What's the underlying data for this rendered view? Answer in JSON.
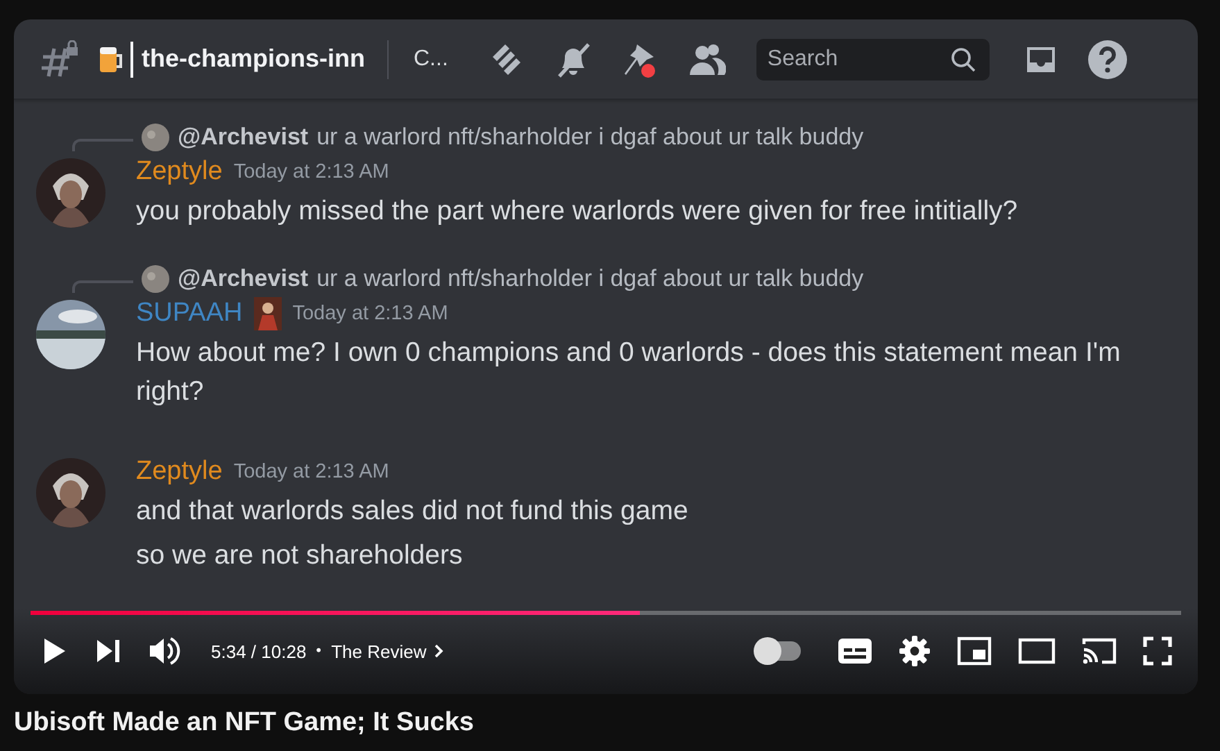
{
  "header": {
    "channel": "the-champions-inn",
    "topic": "C...",
    "search_placeholder": "Search"
  },
  "messages": [
    {
      "reply": {
        "author": "@Archevist",
        "text": "ur a warlord nft/sharholder i dgaf about ur talk buddy"
      },
      "author": "Zeptyle",
      "color": "#e08a1e",
      "role_icon": false,
      "time": "Today at 2:13 AM",
      "lines": [
        "you probably missed the part where warlords were given for free intitially?"
      ]
    },
    {
      "reply": {
        "author": "@Archevist",
        "text": "ur a warlord nft/sharholder i dgaf about ur talk buddy"
      },
      "author": "SUPAAH",
      "color": "#3f86c4",
      "role_icon": true,
      "time": "Today at 2:13 AM",
      "lines": [
        "How about me? I own 0 champions and 0 warlords - does this statement mean I'm right?"
      ]
    },
    {
      "author": "Zeptyle",
      "color": "#e08a1e",
      "role_icon": false,
      "time": "Today at 2:13 AM",
      "lines": [
        "and that warlords sales did not fund this game",
        "so we are not shareholders"
      ]
    }
  ],
  "player": {
    "level": 0.53,
    "playing": false,
    "time": "5:34 / 10:28",
    "separator": "•",
    "chapter": "The Review",
    "autoplay_on": false
  },
  "title": "Ubisoft Made an NFT Game; It Sucks"
}
